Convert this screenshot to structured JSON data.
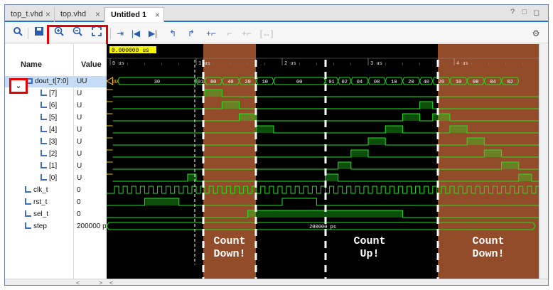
{
  "tabs": [
    {
      "label": "top_t.vhd"
    },
    {
      "label": "top.vhd"
    },
    {
      "label": "Untitled 1"
    }
  ],
  "window_controls": {
    "help": "?",
    "restore": "□",
    "maximize": "◻"
  },
  "columns": {
    "name": "Name",
    "value": "Value"
  },
  "signals": [
    {
      "name": "dout_t[7:0]",
      "value": "UU",
      "kind": "bus",
      "indent": 1
    },
    {
      "name": "[7]",
      "value": "U",
      "kind": "bit",
      "indent": 2
    },
    {
      "name": "[6]",
      "value": "U",
      "kind": "bit",
      "indent": 2
    },
    {
      "name": "[5]",
      "value": "U",
      "kind": "bit",
      "indent": 2
    },
    {
      "name": "[4]",
      "value": "U",
      "kind": "bit",
      "indent": 2
    },
    {
      "name": "[3]",
      "value": "U",
      "kind": "bit",
      "indent": 2
    },
    {
      "name": "[2]",
      "value": "U",
      "kind": "bit",
      "indent": 2
    },
    {
      "name": "[1]",
      "value": "U",
      "kind": "bit",
      "indent": 2
    },
    {
      "name": "[0]",
      "value": "U",
      "kind": "bit",
      "indent": 2
    },
    {
      "name": "clk_t",
      "value": "0",
      "kind": "bit",
      "indent": 1
    },
    {
      "name": "rst_t",
      "value": "0",
      "kind": "bit",
      "indent": 1
    },
    {
      "name": "sel_t",
      "value": "0",
      "kind": "bit",
      "indent": 1
    },
    {
      "name": "step",
      "value": "200000 ps",
      "kind": "bus",
      "indent": 1
    }
  ],
  "cursor_time": "0.000000 us",
  "time_ticks": [
    "0 us",
    "1 us",
    "2 us",
    "3 us",
    "4 us"
  ],
  "bus_values": {
    "initial": "UU",
    "segments": [
      "30",
      "01",
      "80",
      "40",
      "20",
      "10",
      "00",
      "01",
      "02",
      "04",
      "08",
      "10",
      "20",
      "40",
      "20",
      "10",
      "08",
      "04",
      "02"
    ]
  },
  "step_value": "200000 ps",
  "annotations": [
    {
      "line1": "Count",
      "line2": "Down!"
    },
    {
      "line1": "Count",
      "line2": "Up!"
    },
    {
      "line1": "Count",
      "line2": "Down!"
    }
  ],
  "colors": {
    "wave_green": "#1fe21f",
    "region_fill": "#a0522d",
    "highlight_red": "#ea0000",
    "accent_blue": "#1f73c8"
  },
  "scroll": {
    "left": "<",
    "right": ">"
  }
}
